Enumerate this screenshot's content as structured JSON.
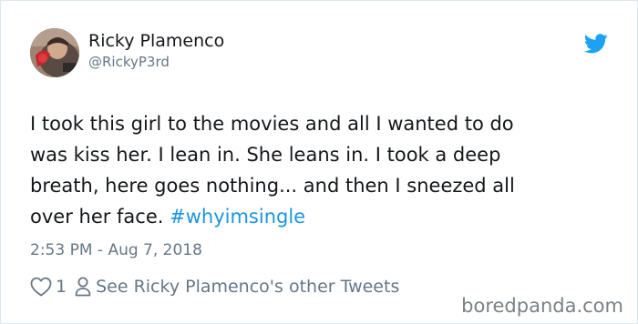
{
  "author": {
    "display_name": "Ricky Plamenco",
    "handle": "@RickyP3rd"
  },
  "brand": {
    "icon": "twitter-bird-icon",
    "color": "#1da1f2"
  },
  "tweet": {
    "lines": [
      "I took this girl to the movies and all I wanted to do",
      "was kiss her. I lean in. She leans in. I took a deep",
      "breath, here goes nothing... and then I sneezed all",
      "over her face. "
    ],
    "hashtag": "#whyimsingle",
    "hashtag_color": "#1b95e0",
    "timestamp": "2:53 PM - Aug 7, 2018"
  },
  "actions": {
    "like_icon": "heart-icon",
    "like_count": "1",
    "profile_icon": "person-icon",
    "other_tweets_label": "See Ricky Plamenco's other Tweets"
  },
  "watermark": {
    "text": "boredpanda.com"
  },
  "colors": {
    "text_primary": "#14171a",
    "text_secondary": "#657786",
    "border": "#e1e8ed"
  }
}
